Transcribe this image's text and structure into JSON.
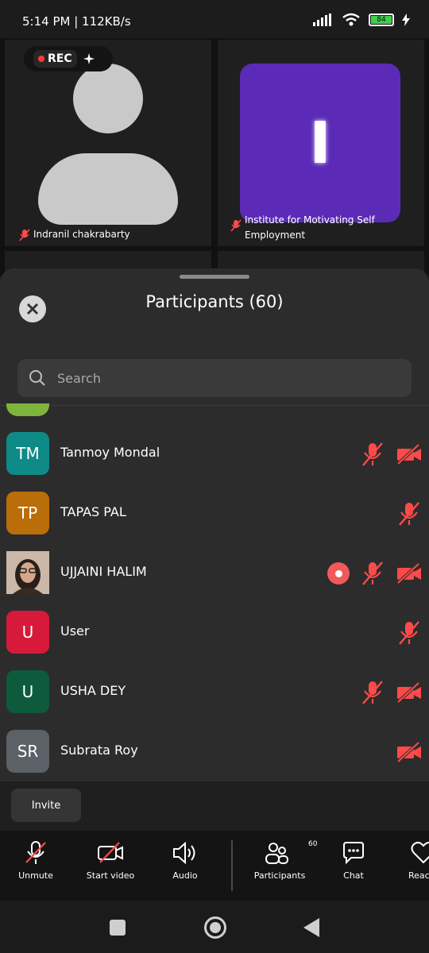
{
  "status_bar": {
    "time": "5:14 PM | 112KB/s",
    "battery": "84"
  },
  "video": {
    "rec_label": "REC",
    "tile1_name": "Indranil chakrabarty",
    "tile2_letter": "I",
    "tile2_name_line1": "Institute for Motivating Self",
    "tile2_name_line2": "Employment"
  },
  "sheet": {
    "title": "Participants (60)",
    "search_placeholder": "Search"
  },
  "participants": [
    {
      "initials": "TM",
      "name": "Tanmoy Mondal",
      "color": "#0e8a87",
      "mic_muted": true,
      "video_off": true,
      "recording": false,
      "photo": false
    },
    {
      "initials": "TP",
      "name": "TAPAS PAL",
      "color": "#b96e0a",
      "mic_muted": true,
      "video_off": false,
      "recording": false,
      "photo": false
    },
    {
      "initials": "",
      "name": "UJJAINI HALIM",
      "color": "#6b4a3a",
      "mic_muted": true,
      "video_off": true,
      "recording": true,
      "photo": true
    },
    {
      "initials": "U",
      "name": "User",
      "color": "#d7193c",
      "mic_muted": true,
      "video_off": false,
      "recording": false,
      "photo": false
    },
    {
      "initials": "U",
      "name": "USHA DEY",
      "color": "#0d5a3c",
      "mic_muted": true,
      "video_off": true,
      "recording": false,
      "photo": false
    },
    {
      "initials": "SR",
      "name": "Subrata Roy",
      "color": "#5b6166",
      "mic_muted": false,
      "video_off": true,
      "recording": false,
      "photo": false
    }
  ],
  "invite": {
    "label": "Invite"
  },
  "toolbar": {
    "unmute": "Unmute",
    "start_video": "Start video",
    "audio": "Audio",
    "participants": "Participants",
    "participants_count": "60",
    "chat": "Chat",
    "reactions": "Reac"
  },
  "colors": {
    "muted_red": "#ff4a4a",
    "sheet_bg": "#2c2c2c"
  }
}
